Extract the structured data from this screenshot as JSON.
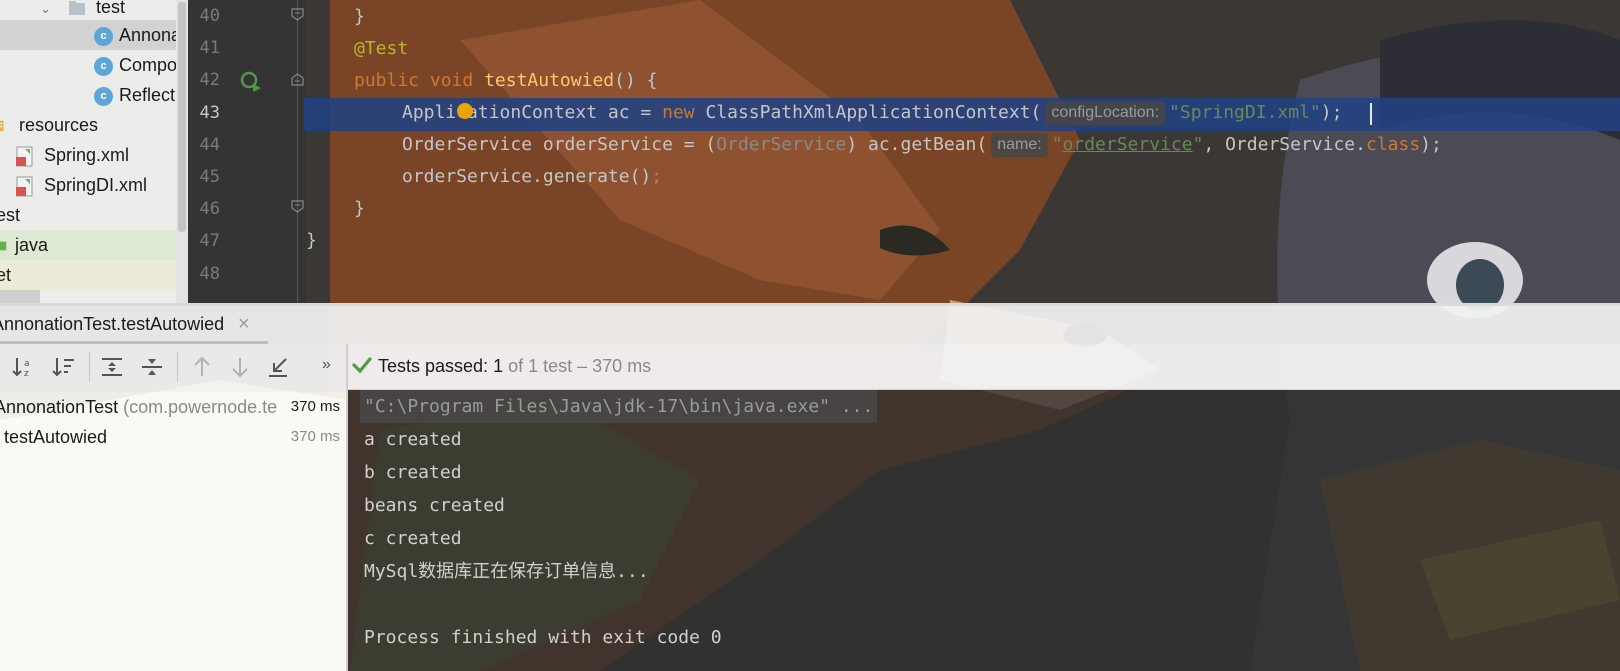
{
  "project_tree": {
    "items": [
      {
        "label": "test",
        "kind": "folder"
      },
      {
        "label": "Annona",
        "kind": "class"
      },
      {
        "label": "Compo",
        "kind": "class"
      },
      {
        "label": "Reflect",
        "kind": "class"
      },
      {
        "label": "resources",
        "kind": "folder"
      },
      {
        "label": "Spring.xml",
        "kind": "xml"
      },
      {
        "label": "SpringDI.xml",
        "kind": "xml"
      },
      {
        "label": "est",
        "kind": "folder"
      },
      {
        "label": "java",
        "kind": "folder"
      },
      {
        "label": "et",
        "kind": "folder"
      }
    ]
  },
  "editor": {
    "line_numbers": [
      "40",
      "41",
      "42",
      "43",
      "44",
      "45",
      "46",
      "47",
      "48"
    ],
    "current_line": "43",
    "code": {
      "l40_brace": "}",
      "l41_annotation": "@Test",
      "l42_public": "public",
      "l42_void": "void",
      "l42_method": "testAutowied",
      "l42_rest": "() {",
      "l43_decl": "ApplicationContext ac = ",
      "l43_new": "new",
      "l43_ctor": " ClassPathXmlApplicationContext(",
      "l43_hint": "configLocation:",
      "l43_string": "\"SpringDI.xml\"",
      "l43_end": ");",
      "l44_decl": "OrderService orderService = (",
      "l44_cast": "OrderService",
      "l44_call": ") ac.getBean(",
      "l44_hint": "name:",
      "l44_q1": "\"",
      "l44_string": "orderService",
      "l44_q2": "\"",
      "l44_args": ", OrderService.",
      "l44_class": "class",
      "l44_end": ");",
      "l45_call": "orderService.generate()",
      "l45_semi": ";",
      "l46_brace": "}",
      "l47_brace": "}"
    }
  },
  "run_panel": {
    "tab_label": "AnnonationTest.testAutowied",
    "tab_close": "×",
    "more": "»",
    "status_label": "Tests passed:",
    "status_count": "1",
    "status_detail": "of 1 test – 370 ms",
    "tree": {
      "root_name": "AnnonationTest",
      "root_pkg": "(com.powernode.te",
      "root_time": "370 ms",
      "child_name": "testAutowied",
      "child_time": "370 ms"
    },
    "console_lines": [
      "\"C:\\Program Files\\Java\\jdk-17\\bin\\java.exe\" ...",
      "a created",
      "b created",
      "beans created",
      "c created",
      "MySql数据库正在保存订单信息...",
      "",
      "Process finished with exit code 0"
    ]
  },
  "colors": {
    "keyword": "#cc7832",
    "method": "#ffc66d",
    "annotation": "#bbb529",
    "string": "#6a8759",
    "selection": "#214283",
    "pass_green": "#4f9a45"
  }
}
